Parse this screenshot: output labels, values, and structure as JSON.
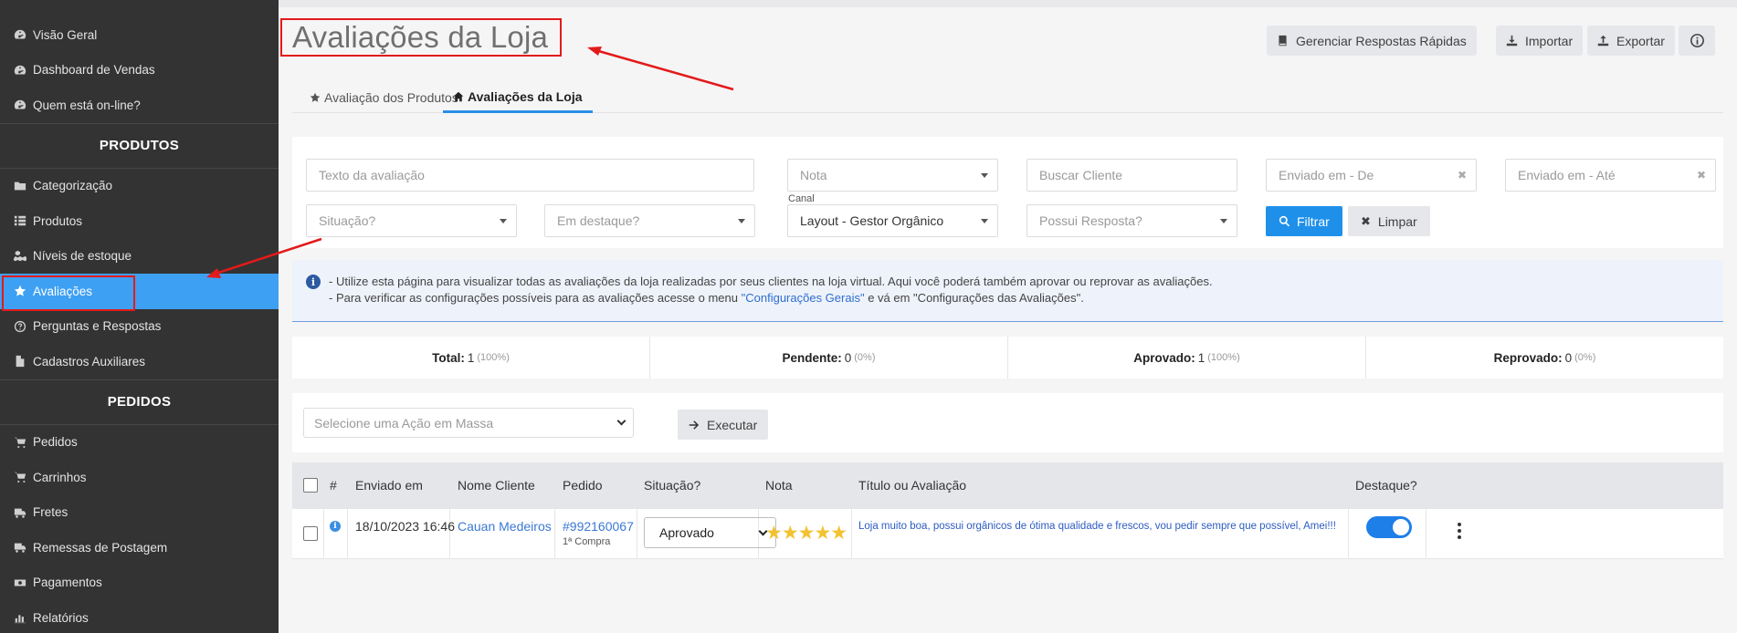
{
  "sidebar": {
    "items_top": [
      {
        "label": "Visão Geral",
        "icon": "dashboard-icon"
      },
      {
        "label": "Dashboard de Vendas",
        "icon": "dashboard-icon"
      },
      {
        "label": "Quem está on-line?",
        "icon": "dashboard-icon"
      }
    ],
    "section_produtos": "PRODUTOS",
    "items_produtos": [
      {
        "label": "Categorização",
        "icon": "folder-icon"
      },
      {
        "label": "Produtos",
        "icon": "list-icon"
      },
      {
        "label": "Níveis de estoque",
        "icon": "cubes-icon"
      },
      {
        "label": "Avaliações",
        "icon": "star-icon"
      },
      {
        "label": "Perguntas e Respostas",
        "icon": "question-circle-icon"
      },
      {
        "label": "Cadastros Auxiliares",
        "icon": "file-icon"
      }
    ],
    "section_pedidos": "PEDIDOS",
    "items_pedidos": [
      {
        "label": "Pedidos",
        "icon": "cart-icon"
      },
      {
        "label": "Carrinhos",
        "icon": "cart-icon"
      },
      {
        "label": "Fretes",
        "icon": "truck-icon"
      },
      {
        "label": "Remessas de Postagem",
        "icon": "truck-icon"
      },
      {
        "label": "Pagamentos",
        "icon": "money-icon"
      },
      {
        "label": "Relatórios",
        "icon": "chart-icon"
      }
    ]
  },
  "header": {
    "title": "Avaliações da Loja",
    "buttons": {
      "quick_replies": "Gerenciar Respostas Rápidas",
      "import": "Importar",
      "export": "Exportar"
    }
  },
  "tabs": [
    {
      "label": "Avaliação dos Produtos",
      "icon": "star-icon"
    },
    {
      "label": "Avaliações da Loja",
      "icon": "home-icon"
    }
  ],
  "filters": {
    "review_text_placeholder": "Texto da avaliação",
    "nota_placeholder": "Nota",
    "customer_placeholder": "Buscar Cliente",
    "sent_from_placeholder": "Enviado em - De",
    "sent_to_placeholder": "Enviado em - Até",
    "status_placeholder": "Situação?",
    "featured_placeholder": "Em destaque?",
    "canal_label": "Canal",
    "canal_value": "Layout - Gestor Orgânico",
    "has_reply_placeholder": "Possui Resposta?",
    "filter_button": "Filtrar",
    "clear_button": "Limpar"
  },
  "info": {
    "line1": "- Utilize esta página para visualizar todas as avaliações da loja realizadas por seus clientes na loja virtual. Aqui você poderá também aprovar ou reprovar as avaliações.",
    "line2_prefix": "- Para verificar as configurações possíveis para as avaliações acesse o menu ",
    "line2_link": "\"Configurações Gerais\"",
    "line2_suffix": " e vá em \"Configurações das Avaliações\"."
  },
  "stats": [
    {
      "label": "Total:",
      "value": "1",
      "pct": "(100%)"
    },
    {
      "label": "Pendente:",
      "value": "0",
      "pct": "(0%)"
    },
    {
      "label": "Aprovado:",
      "value": "1",
      "pct": "(100%)"
    },
    {
      "label": "Reprovado:",
      "value": "0",
      "pct": "(0%)"
    }
  ],
  "bulk": {
    "select_placeholder": "Selecione uma Ação em Massa",
    "execute_button": "Executar"
  },
  "table": {
    "headers": {
      "hash": "#",
      "sent": "Enviado em",
      "customer": "Nome Cliente",
      "order": "Pedido",
      "status": "Situação?",
      "rating": "Nota",
      "title": "Título ou Avaliação",
      "featured": "Destaque?"
    },
    "rows": [
      {
        "sent": "18/10/2023 16:46",
        "customer": "Cauan Medeiros",
        "order": "#992160067",
        "order_sub": "1ª Compra",
        "status": "Aprovado",
        "stars": "★★★★★",
        "rating": 5,
        "review": "Loja muito boa, possui orgânicos de ótima qualidade e frescos, vou pedir sempre que possível, Amei!!!",
        "featured": true
      }
    ]
  },
  "colors": {
    "sidebar_bg": "#333333",
    "active_item": "#3ea0f3",
    "primary": "#1e90ea",
    "annotation_red": "#e31a1a"
  }
}
